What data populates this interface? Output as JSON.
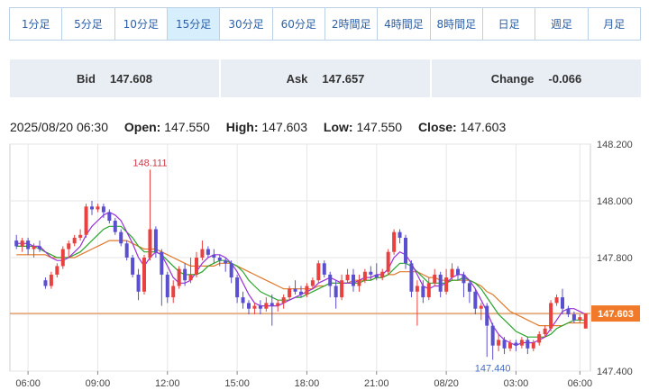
{
  "timeframes": [
    {
      "label": "1分足",
      "active": false
    },
    {
      "label": "5分足",
      "active": false
    },
    {
      "label": "10分足",
      "active": false
    },
    {
      "label": "15分足",
      "active": true
    },
    {
      "label": "30分足",
      "active": false
    },
    {
      "label": "60分足",
      "active": false
    },
    {
      "label": "2時間足",
      "active": false
    },
    {
      "label": "4時間足",
      "active": false
    },
    {
      "label": "8時間足",
      "active": false
    },
    {
      "label": "日足",
      "active": false
    },
    {
      "label": "週足",
      "active": false
    },
    {
      "label": "月足",
      "active": false
    }
  ],
  "quote": {
    "bid_label": "Bid",
    "bid_value": "147.608",
    "ask_label": "Ask",
    "ask_value": "147.657",
    "change_label": "Change",
    "change_value": "-0.066"
  },
  "ohlc": {
    "datetime": "2025/08/20 06:30",
    "open_label": "Open:",
    "open_value": "147.550",
    "high_label": "High:",
    "high_value": "147.603",
    "low_label": "Low:",
    "low_value": "147.550",
    "close_label": "Close:",
    "close_value": "147.603"
  },
  "colors": {
    "up": "#e8413f",
    "down": "#5a4fcf",
    "ma_short": "#9b30d9",
    "ma_mid": "#2aa52a",
    "ma_long": "#e0782a",
    "price_line": "#e07b2a",
    "price_tag": "#f07a2a",
    "grid": "#e6e6e6"
  },
  "chart_data": {
    "type": "candlestick",
    "y_ticks": [
      "148.200",
      "148.000",
      "147.800",
      "147.600",
      "147.400"
    ],
    "x_ticks": [
      "06:00",
      "09:00",
      "12:00",
      "15:00",
      "18:00",
      "21:00",
      "08/20",
      "03:00",
      "06:00"
    ],
    "ylim": [
      147.4,
      148.2
    ],
    "current_price": "147.603",
    "high_annotation": "148.111",
    "low_annotation": "147.440",
    "candles": [
      [
        147.86,
        147.84,
        147.88,
        147.83
      ],
      [
        147.84,
        147.86,
        147.87,
        147.82
      ],
      [
        147.86,
        147.83,
        147.87,
        147.81
      ],
      [
        147.83,
        147.84,
        147.85,
        147.8
      ],
      [
        147.84,
        147.83,
        147.86,
        147.82
      ],
      [
        147.72,
        147.7,
        147.73,
        147.69
      ],
      [
        147.7,
        147.74,
        147.75,
        147.69
      ],
      [
        147.74,
        147.77,
        147.78,
        147.73
      ],
      [
        147.77,
        147.83,
        147.84,
        147.76
      ],
      [
        147.83,
        147.85,
        147.86,
        147.8
      ],
      [
        147.85,
        147.87,
        147.88,
        147.84
      ],
      [
        147.87,
        147.88,
        147.9,
        147.86
      ],
      [
        147.88,
        147.98,
        147.99,
        147.87
      ],
      [
        147.98,
        147.97,
        148.0,
        147.95
      ],
      [
        147.97,
        147.98,
        147.99,
        147.96
      ],
      [
        147.98,
        147.96,
        147.99,
        147.94
      ],
      [
        147.96,
        147.93,
        147.97,
        147.92
      ],
      [
        147.93,
        147.89,
        147.94,
        147.88
      ],
      [
        147.89,
        147.85,
        147.9,
        147.84
      ],
      [
        147.85,
        147.8,
        147.86,
        147.79
      ],
      [
        147.8,
        147.74,
        147.81,
        147.73
      ],
      [
        147.74,
        147.68,
        147.76,
        147.65
      ],
      [
        147.68,
        147.8,
        147.81,
        147.67
      ],
      [
        147.8,
        147.9,
        148.11,
        147.79
      ],
      [
        147.9,
        147.82,
        147.91,
        147.8
      ],
      [
        147.82,
        147.74,
        147.83,
        147.63
      ],
      [
        147.74,
        147.66,
        147.75,
        147.64
      ],
      [
        147.66,
        147.7,
        147.72,
        147.64
      ],
      [
        147.7,
        147.76,
        147.77,
        147.69
      ],
      [
        147.76,
        147.72,
        147.78,
        147.7
      ],
      [
        147.72,
        147.74,
        147.8,
        147.71
      ],
      [
        147.74,
        147.8,
        147.82,
        147.73
      ],
      [
        147.8,
        147.83,
        147.86,
        147.79
      ],
      [
        147.83,
        147.81,
        147.84,
        147.8
      ],
      [
        147.81,
        147.8,
        147.83,
        147.78
      ],
      [
        147.8,
        147.79,
        147.81,
        147.77
      ],
      [
        147.79,
        147.78,
        147.8,
        147.75
      ],
      [
        147.78,
        147.73,
        147.79,
        147.71
      ],
      [
        147.73,
        147.66,
        147.74,
        147.64
      ],
      [
        147.66,
        147.64,
        147.68,
        147.62
      ],
      [
        147.64,
        147.62,
        147.65,
        147.6
      ],
      [
        147.62,
        147.63,
        147.64,
        147.6
      ],
      [
        147.63,
        147.62,
        147.65,
        147.6
      ],
      [
        147.62,
        147.64,
        147.66,
        147.61
      ],
      [
        147.64,
        147.63,
        147.67,
        147.56
      ],
      [
        147.63,
        147.64,
        147.65,
        147.61
      ],
      [
        147.64,
        147.66,
        147.67,
        147.62
      ],
      [
        147.66,
        147.69,
        147.7,
        147.65
      ],
      [
        147.69,
        147.68,
        147.72,
        147.67
      ],
      [
        147.68,
        147.67,
        147.7,
        147.66
      ],
      [
        147.67,
        147.7,
        147.71,
        147.66
      ],
      [
        147.7,
        147.72,
        147.73,
        147.69
      ],
      [
        147.72,
        147.78,
        147.79,
        147.71
      ],
      [
        147.78,
        147.74,
        147.79,
        147.73
      ],
      [
        147.74,
        147.7,
        147.75,
        147.66
      ],
      [
        147.7,
        147.66,
        147.72,
        147.62
      ],
      [
        147.66,
        147.72,
        147.74,
        147.65
      ],
      [
        147.72,
        147.74,
        147.76,
        147.71
      ],
      [
        147.74,
        147.7,
        147.76,
        147.68
      ],
      [
        147.7,
        147.72,
        147.74,
        147.68
      ],
      [
        147.72,
        147.75,
        147.76,
        147.71
      ],
      [
        147.75,
        147.74,
        147.77,
        147.72
      ],
      [
        147.74,
        147.73,
        147.78,
        147.72
      ],
      [
        147.73,
        147.75,
        147.76,
        147.72
      ],
      [
        147.75,
        147.82,
        147.83,
        147.74
      ],
      [
        147.82,
        147.89,
        147.9,
        147.81
      ],
      [
        147.89,
        147.87,
        147.9,
        147.85
      ],
      [
        147.87,
        147.78,
        147.88,
        147.76
      ],
      [
        147.78,
        147.68,
        147.79,
        147.66
      ],
      [
        147.68,
        147.7,
        147.72,
        147.56
      ],
      [
        147.7,
        147.66,
        147.72,
        147.64
      ],
      [
        147.66,
        147.71,
        147.73,
        147.65
      ],
      [
        147.71,
        147.74,
        147.76,
        147.7
      ],
      [
        147.74,
        147.68,
        147.75,
        147.66
      ],
      [
        147.68,
        147.73,
        147.76,
        147.67
      ],
      [
        147.73,
        147.76,
        147.78,
        147.72
      ],
      [
        147.76,
        147.74,
        147.77,
        147.72
      ],
      [
        147.74,
        147.71,
        147.75,
        147.66
      ],
      [
        147.71,
        147.68,
        147.72,
        147.64
      ],
      [
        147.68,
        147.62,
        147.69,
        147.6
      ],
      [
        147.62,
        147.63,
        147.64,
        147.58
      ],
      [
        147.63,
        147.56,
        147.64,
        147.45
      ],
      [
        147.56,
        147.49,
        147.57,
        147.44
      ],
      [
        147.49,
        147.51,
        147.53,
        147.47
      ],
      [
        147.51,
        147.48,
        147.52,
        147.46
      ],
      [
        147.48,
        147.5,
        147.51,
        147.47
      ],
      [
        147.5,
        147.49,
        147.51,
        147.47
      ],
      [
        147.49,
        147.51,
        147.52,
        147.48
      ],
      [
        147.51,
        147.48,
        147.52,
        147.46
      ],
      [
        147.48,
        147.5,
        147.51,
        147.47
      ],
      [
        147.5,
        147.53,
        147.54,
        147.49
      ],
      [
        147.53,
        147.55,
        147.56,
        147.52
      ],
      [
        147.55,
        147.64,
        147.65,
        147.54
      ],
      [
        147.64,
        147.66,
        147.67,
        147.63
      ],
      [
        147.66,
        147.62,
        147.69,
        147.6
      ],
      [
        147.62,
        147.6,
        147.63,
        147.59
      ],
      [
        147.6,
        147.58,
        147.61,
        147.57
      ],
      [
        147.58,
        147.59,
        147.6,
        147.57
      ],
      [
        147.55,
        147.603,
        147.603,
        147.55
      ]
    ],
    "ma_short": [
      147.85,
      147.85,
      147.85,
      147.84,
      147.84,
      147.82,
      147.8,
      147.79,
      147.79,
      147.8,
      147.82,
      147.84,
      147.88,
      147.91,
      147.93,
      147.95,
      147.96,
      147.95,
      147.93,
      147.89,
      147.85,
      147.8,
      147.77,
      147.8,
      147.82,
      147.81,
      147.77,
      147.73,
      147.71,
      147.71,
      147.72,
      147.75,
      147.78,
      147.8,
      147.81,
      147.81,
      147.8,
      147.78,
      147.75,
      147.71,
      147.67,
      147.64,
      147.63,
      147.63,
      147.63,
      147.63,
      147.64,
      147.65,
      147.66,
      147.67,
      147.68,
      147.69,
      147.71,
      147.72,
      147.73,
      147.72,
      147.71,
      147.71,
      147.71,
      147.72,
      147.73,
      147.73,
      147.74,
      147.74,
      147.76,
      147.8,
      147.82,
      147.81,
      147.78,
      147.74,
      147.7,
      147.69,
      147.7,
      147.7,
      147.71,
      147.73,
      147.74,
      147.74,
      147.72,
      147.69,
      147.65,
      147.61,
      147.56,
      147.53,
      147.51,
      147.5,
      147.49,
      147.5,
      147.5,
      147.5,
      147.51,
      147.52,
      147.55,
      147.58,
      147.61,
      147.62,
      147.62,
      147.61,
      147.6
    ],
    "ma_mid": [
      147.84,
      147.84,
      147.84,
      147.84,
      147.83,
      147.82,
      147.81,
      147.8,
      147.8,
      147.8,
      147.81,
      147.82,
      147.84,
      147.86,
      147.88,
      147.9,
      147.91,
      147.91,
      147.91,
      147.89,
      147.87,
      147.84,
      147.82,
      147.82,
      147.82,
      147.81,
      147.79,
      147.77,
      147.75,
      147.74,
      147.74,
      147.74,
      147.75,
      147.77,
      147.78,
      147.79,
      147.79,
      147.78,
      147.77,
      147.75,
      147.72,
      147.7,
      147.68,
      147.67,
      147.66,
      147.65,
      147.65,
      147.65,
      147.66,
      147.66,
      147.67,
      147.68,
      147.69,
      147.7,
      147.71,
      147.71,
      147.71,
      147.71,
      147.71,
      147.71,
      147.72,
      147.72,
      147.73,
      147.73,
      147.74,
      147.76,
      147.78,
      147.78,
      147.77,
      147.75,
      147.73,
      147.71,
      147.71,
      147.71,
      147.71,
      147.72,
      147.72,
      147.73,
      147.72,
      147.71,
      147.69,
      147.66,
      147.63,
      147.6,
      147.58,
      147.56,
      147.54,
      147.53,
      147.52,
      147.52,
      147.52,
      147.52,
      147.53,
      147.55,
      147.56,
      147.57,
      147.58,
      147.58,
      147.58
    ],
    "ma_long": [
      147.81,
      147.81,
      147.81,
      147.81,
      147.81,
      147.81,
      147.8,
      147.8,
      147.8,
      147.8,
      147.8,
      147.81,
      147.82,
      147.83,
      147.84,
      147.85,
      147.86,
      147.86,
      147.86,
      147.86,
      147.85,
      147.84,
      147.83,
      147.83,
      147.83,
      147.82,
      147.81,
      147.8,
      147.79,
      147.78,
      147.77,
      147.77,
      147.77,
      147.77,
      147.77,
      147.78,
      147.78,
      147.78,
      147.77,
      147.76,
      147.75,
      147.74,
      147.73,
      147.72,
      147.71,
      147.7,
      147.69,
      147.69,
      147.69,
      147.69,
      147.69,
      147.69,
      147.7,
      147.7,
      147.71,
      147.71,
      147.71,
      147.71,
      147.72,
      147.72,
      147.72,
      147.72,
      147.73,
      147.73,
      147.74,
      147.74,
      147.75,
      147.75,
      147.75,
      147.75,
      147.74,
      147.73,
      147.73,
      147.72,
      147.72,
      147.72,
      147.72,
      147.72,
      147.72,
      147.71,
      147.7,
      147.68,
      147.67,
      147.65,
      147.63,
      147.61,
      147.6,
      147.59,
      147.58,
      147.57,
      147.56,
      147.56,
      147.56,
      147.56,
      147.56,
      147.57,
      147.57,
      147.57,
      147.57
    ]
  }
}
